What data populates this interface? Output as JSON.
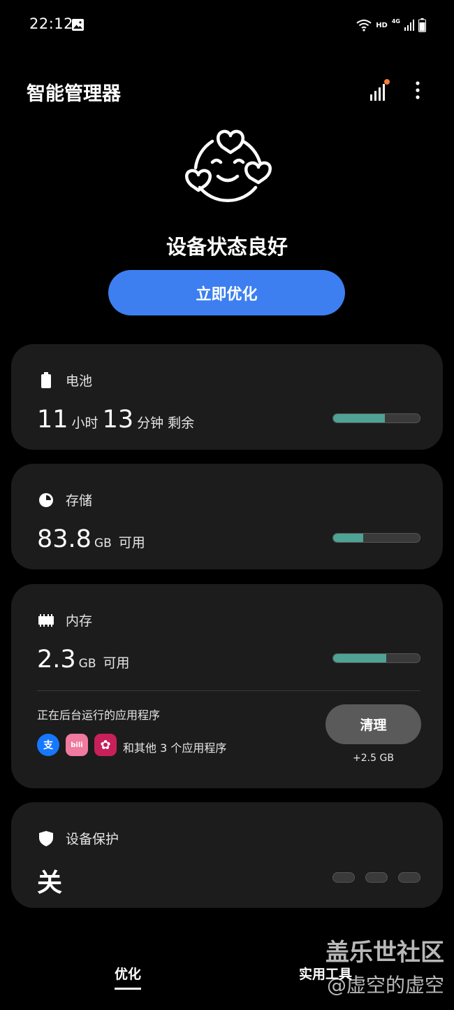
{
  "status_bar": {
    "time": "22:12",
    "network_hd": "HD",
    "network_4g": "4G"
  },
  "app": {
    "title": "智能管理器"
  },
  "hero": {
    "status": "设备状态良好",
    "optimize_label": "立即优化"
  },
  "battery": {
    "title": "电池",
    "hours": "11",
    "hours_unit": "小时",
    "minutes": "13",
    "minutes_unit": "分钟",
    "suffix": "剩余",
    "level": 0.6
  },
  "storage": {
    "title": "存储",
    "value": "83.8",
    "unit": "GB",
    "suffix": "可用",
    "used": 0.35
  },
  "memory": {
    "title": "内存",
    "value": "2.3",
    "unit": "GB",
    "suffix": "可用",
    "used": 0.61,
    "background_label": "正在后台运行的应用程序",
    "others_label": "和其他 3 个应用程序",
    "clean_label": "清理",
    "freed_label": "+2.5 GB",
    "apps": [
      {
        "name": "alipay-icon",
        "glyph": "支",
        "color": "#1677ff"
      },
      {
        "name": "bilibili-icon",
        "glyph": "bili",
        "color": "#f07aa0"
      },
      {
        "name": "flower-app-icon",
        "glyph": "✿",
        "color": "#c8205a"
      }
    ]
  },
  "protection": {
    "title": "设备保护",
    "status": "关"
  },
  "nav": {
    "tab_optimize": "优化",
    "tab_tools": "实用工具"
  },
  "watermark": {
    "line1": "盖乐世社区",
    "line2": "@虚空的虚空"
  },
  "colors": {
    "accent": "#3d7ff0",
    "progress": "#4ea394",
    "card": "#1c1c1c"
  }
}
